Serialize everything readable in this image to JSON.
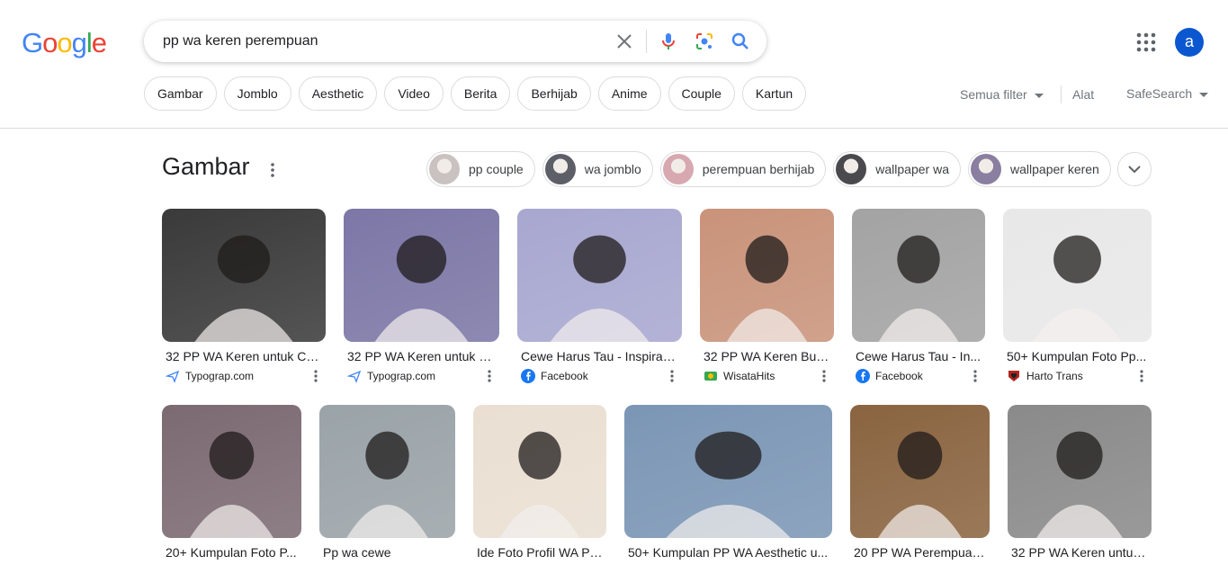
{
  "logo": {
    "letters": [
      "G",
      "o",
      "o",
      "g",
      "l",
      "e"
    ],
    "colors": [
      "#4285F4",
      "#EA4335",
      "#FBBC05",
      "#4285F4",
      "#34A853",
      "#EA4335"
    ]
  },
  "search": {
    "query": "pp wa keren perempuan"
  },
  "account": {
    "initial": "a"
  },
  "chips": [
    "Gambar",
    "Jomblo",
    "Aesthetic",
    "Video",
    "Berita",
    "Berhijab",
    "Anime",
    "Couple",
    "Kartun"
  ],
  "tools": {
    "all_filters": "Semua filter",
    "tools": "Alat",
    "safesearch": "SafeSearch"
  },
  "section": {
    "title": "Gambar"
  },
  "related": [
    {
      "label": "pp couple",
      "thumb": "#c9c2c0"
    },
    {
      "label": "wa jomblo",
      "thumb": "#5d5f68"
    },
    {
      "label": "perempuan berhijab",
      "thumb": "#d7a8b0"
    },
    {
      "label": "wallpaper wa",
      "thumb": "#4a4a4e"
    },
    {
      "label": "wallpaper keren",
      "thumb": "#8a7fa0"
    }
  ],
  "results_row1": [
    {
      "title": "32 PP WA Keren untuk Co...",
      "source": "Typograp.com",
      "icon": "paper-plane-icon",
      "color": "#3a3a3a"
    },
    {
      "title": "32 PP WA Keren untuk C...",
      "source": "Typograp.com",
      "icon": "paper-plane-icon",
      "color": "#7c77a6"
    },
    {
      "title": "Cewe Harus Tau - Inspirasi...",
      "source": "Facebook",
      "icon": "facebook-icon",
      "color": "#a8a7d0"
    },
    {
      "title": "32 PP WA Keren Buat...",
      "source": "WisataHits",
      "icon": "wisatahits-icon",
      "color": "#c9937a"
    },
    {
      "title": "Cewe Harus Tau - In...",
      "source": "Facebook",
      "icon": "facebook-icon",
      "color": "#a3a3a3"
    },
    {
      "title": "50+ Kumpulan Foto Pp...",
      "source": "Harto Trans",
      "icon": "hartotrans-icon",
      "color": "#e8e8e8"
    }
  ],
  "results_row2": [
    {
      "title": "20+ Kumpulan Foto P...",
      "color": "#7c6a72"
    },
    {
      "title": "Pp wa cewe",
      "color": "#9aa3a8"
    },
    {
      "title": "Ide Foto Profil WA Pe...",
      "color": "#eadfd2"
    },
    {
      "title": "50+ Kumpulan PP WA Aesthetic u...",
      "color": "#7b96b5"
    },
    {
      "title": "20 PP WA Perempuan...",
      "color": "#8a6440"
    },
    {
      "title": "32 PP WA Keren untuk ...",
      "color": "#8a8a8a"
    }
  ]
}
